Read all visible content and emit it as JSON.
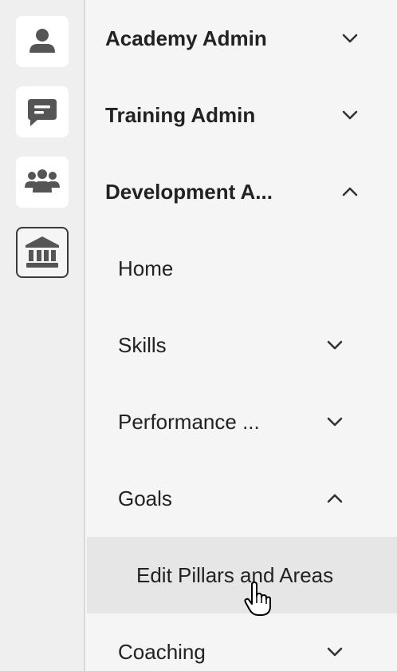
{
  "rail": {
    "items": [
      {
        "icon": "user-icon",
        "active": false
      },
      {
        "icon": "message-icon",
        "active": false
      },
      {
        "icon": "group-icon",
        "active": false
      },
      {
        "icon": "institution-icon",
        "active": true
      }
    ]
  },
  "menu": {
    "academy_admin": {
      "label": "Academy Admin",
      "state": "collapsed"
    },
    "training_admin": {
      "label": "Training Admin",
      "state": "collapsed"
    },
    "development_admin": {
      "label": "Development A...",
      "state": "expanded",
      "children": {
        "home": {
          "label": "Home"
        },
        "skills": {
          "label": "Skills",
          "state": "collapsed"
        },
        "performance": {
          "label": "Performance ...",
          "state": "collapsed"
        },
        "goals": {
          "label": "Goals",
          "state": "expanded",
          "children": {
            "edit_pillars": {
              "label": "Edit Pillars and Areas"
            }
          }
        },
        "coaching": {
          "label": "Coaching",
          "state": "collapsed"
        }
      }
    }
  },
  "colors": {
    "rail_bg": "#efefef",
    "panel_bg": "#f5f5f5",
    "hover_bg": "#e6e6e6",
    "icon": "#555555",
    "text": "#222222"
  }
}
